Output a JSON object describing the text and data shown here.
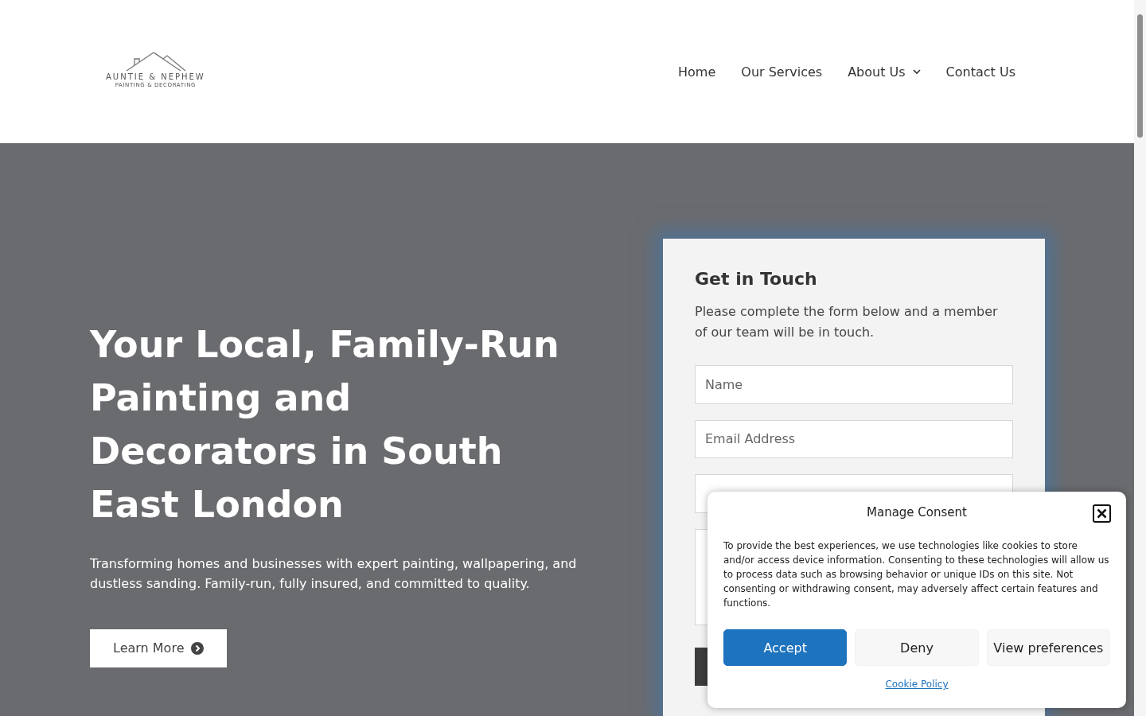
{
  "logo": {
    "name": "AUNTIE & NEPHEW",
    "tagline": "PAINTING & DECORATING"
  },
  "nav": [
    {
      "label": "Home",
      "has_submenu": false
    },
    {
      "label": "Our Services",
      "has_submenu": false
    },
    {
      "label": "About Us",
      "has_submenu": true
    },
    {
      "label": "Contact Us",
      "has_submenu": false
    }
  ],
  "hero": {
    "heading": "Your Local, Family-Run Painting and Decorators in South East London",
    "text": "Transforming homes and businesses with expert painting, wallpapering, and dustless sanding. Family-run, fully insured, and committed to quality.",
    "button": "Learn More"
  },
  "form": {
    "title": "Get in Touch",
    "intro": "Please complete the form below and a member of our team will be in touch.",
    "fields": [
      {
        "kind": "input",
        "placeholder": "Name"
      },
      {
        "kind": "input",
        "placeholder": "Email Address"
      },
      {
        "kind": "input"
      },
      {
        "kind": "textarea"
      }
    ]
  },
  "consent": {
    "title": "Manage Consent",
    "text": "To provide the best experiences, we use technologies like cookies to store and/or access device information. Consenting to these technologies will allow us to process data such as browsing behavior or unique IDs on this site. Not consenting or withdrawing consent, may adversely affect certain features and functions.",
    "buttons": [
      {
        "label": "Accept",
        "primary": true
      },
      {
        "label": "Deny",
        "primary": false
      },
      {
        "label": "View preferences",
        "primary": false
      }
    ],
    "link": "Cookie Policy"
  }
}
